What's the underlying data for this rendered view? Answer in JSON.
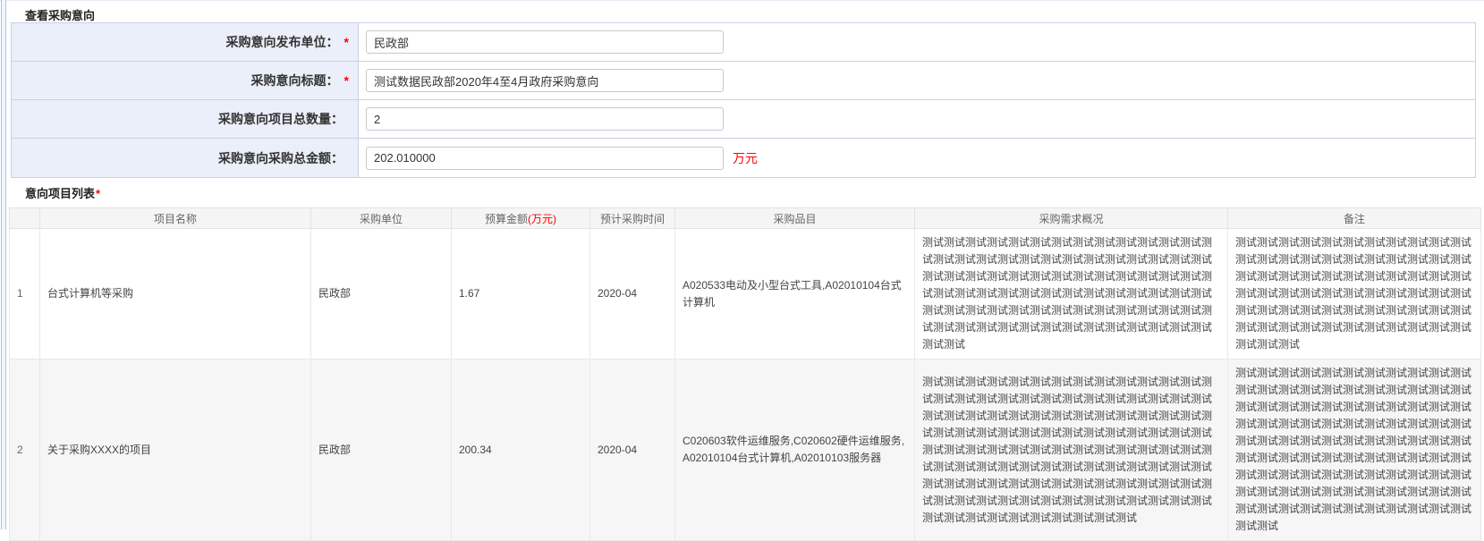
{
  "header": {
    "title": "查看采购意向"
  },
  "colors": {
    "required_red": "#ff0000",
    "label_bg": "#ebeff9",
    "form_border": "#c6d1e3",
    "zebra_row": "#f6f6f7"
  },
  "form": {
    "rows": [
      {
        "label": "采购意向发布单位：",
        "required": "*",
        "value": "民政部",
        "suffix": ""
      },
      {
        "label": "采购意向标题：",
        "required": "*",
        "value": "测试数据民政部2020年4至4月政府采购意向",
        "suffix": ""
      },
      {
        "label": "采购意向项目总数量：",
        "required": "",
        "value": "2",
        "suffix": ""
      },
      {
        "label": "采购意向采购总金额：",
        "required": "",
        "value": "202.010000",
        "suffix": "万元"
      }
    ]
  },
  "list": {
    "title": "意向项目列表",
    "required": "*"
  },
  "table": {
    "headers": {
      "index": "",
      "name": "项目名称",
      "unit": "采购单位",
      "budget_prefix": "预算金额",
      "budget_unit": "(万元)",
      "time": "预计采购时间",
      "items": "采购品目",
      "demand": "采购需求概况",
      "remark": "备注"
    },
    "rows": [
      {
        "index": "1",
        "name": "台式计算机等采购",
        "unit": "民政部",
        "budget": "1.67",
        "time": "2020-04",
        "items": "A020533电动及小型台式工具,A02010104台式计算机",
        "demand": "测试测试测试测试测试测试测试测试测试测试测试测试测试测试测试测试测试测试测试测试测试测试测试测试测试测试测试测试测试测试测试测试测试测试测试测试测试测试测试测试测试测试测试测试测试测试测试测试测试测试测试测试测试测试测试测试测试测试测试测试测试测试测试测试测试测试测试测试测试测试测试测试测试测试测试测试测试测试测试测试测试测试测试",
        "remark": "测试测试测试测试测试测试测试测试测试测试测试测试测试测试测试测试测试测试测试测试测试测试测试测试测试测试测试测试测试测试测试测试测试测试测试测试测试测试测试测试测试测试测试测试测试测试测试测试测试测试测试测试测试测试测试测试测试测试测试测试测试测试测试测试测试测试测试测试测试"
      },
      {
        "index": "2",
        "name": "关于采购XXXX的项目",
        "unit": "民政部",
        "budget": "200.34",
        "time": "2020-04",
        "items": "C020603软件运维服务,C020602硬件运维服务,A02010104台式计算机,A02010103服务器",
        "demand": "测试测试测试测试测试测试测试测试测试测试测试测试测试测试测试测试测试测试测试测试测试测试测试测试测试测试测试测试测试测试测试测试测试测试测试测试测试测试测试测试测试测试测试测试测试测试测试测试测试测试测试测试测试测试测试测试测试测试测试测试测试测试测试测试测试测试测试测试测试测试测试测试测试测试测试测试测试测试测试测试测试测试测试测试测试测试测试测试测试测试测试测试测试测试测试测试测试测试测试测试测试测试测试测试测试测试测试测试测试测试测试测试测试测试测试测试测试测试",
        "remark": "测试测试测试测试测试测试测试测试测试测试测试测试测试测试测试测试测试测试测试测试测试测试测试测试测试测试测试测试测试测试测试测试测试测试测试测试测试测试测试测试测试测试测试测试测试测试测试测试测试测试测试测试测试测试测试测试测试测试测试测试测试测试测试测试测试测试测试测试测试测试测试测试测试测试测试测试测试测试测试测试测试测试测试测试测试测试测试测试测试测试测试测试测试测试测试测试测试测试测试测试测试"
      }
    ]
  }
}
